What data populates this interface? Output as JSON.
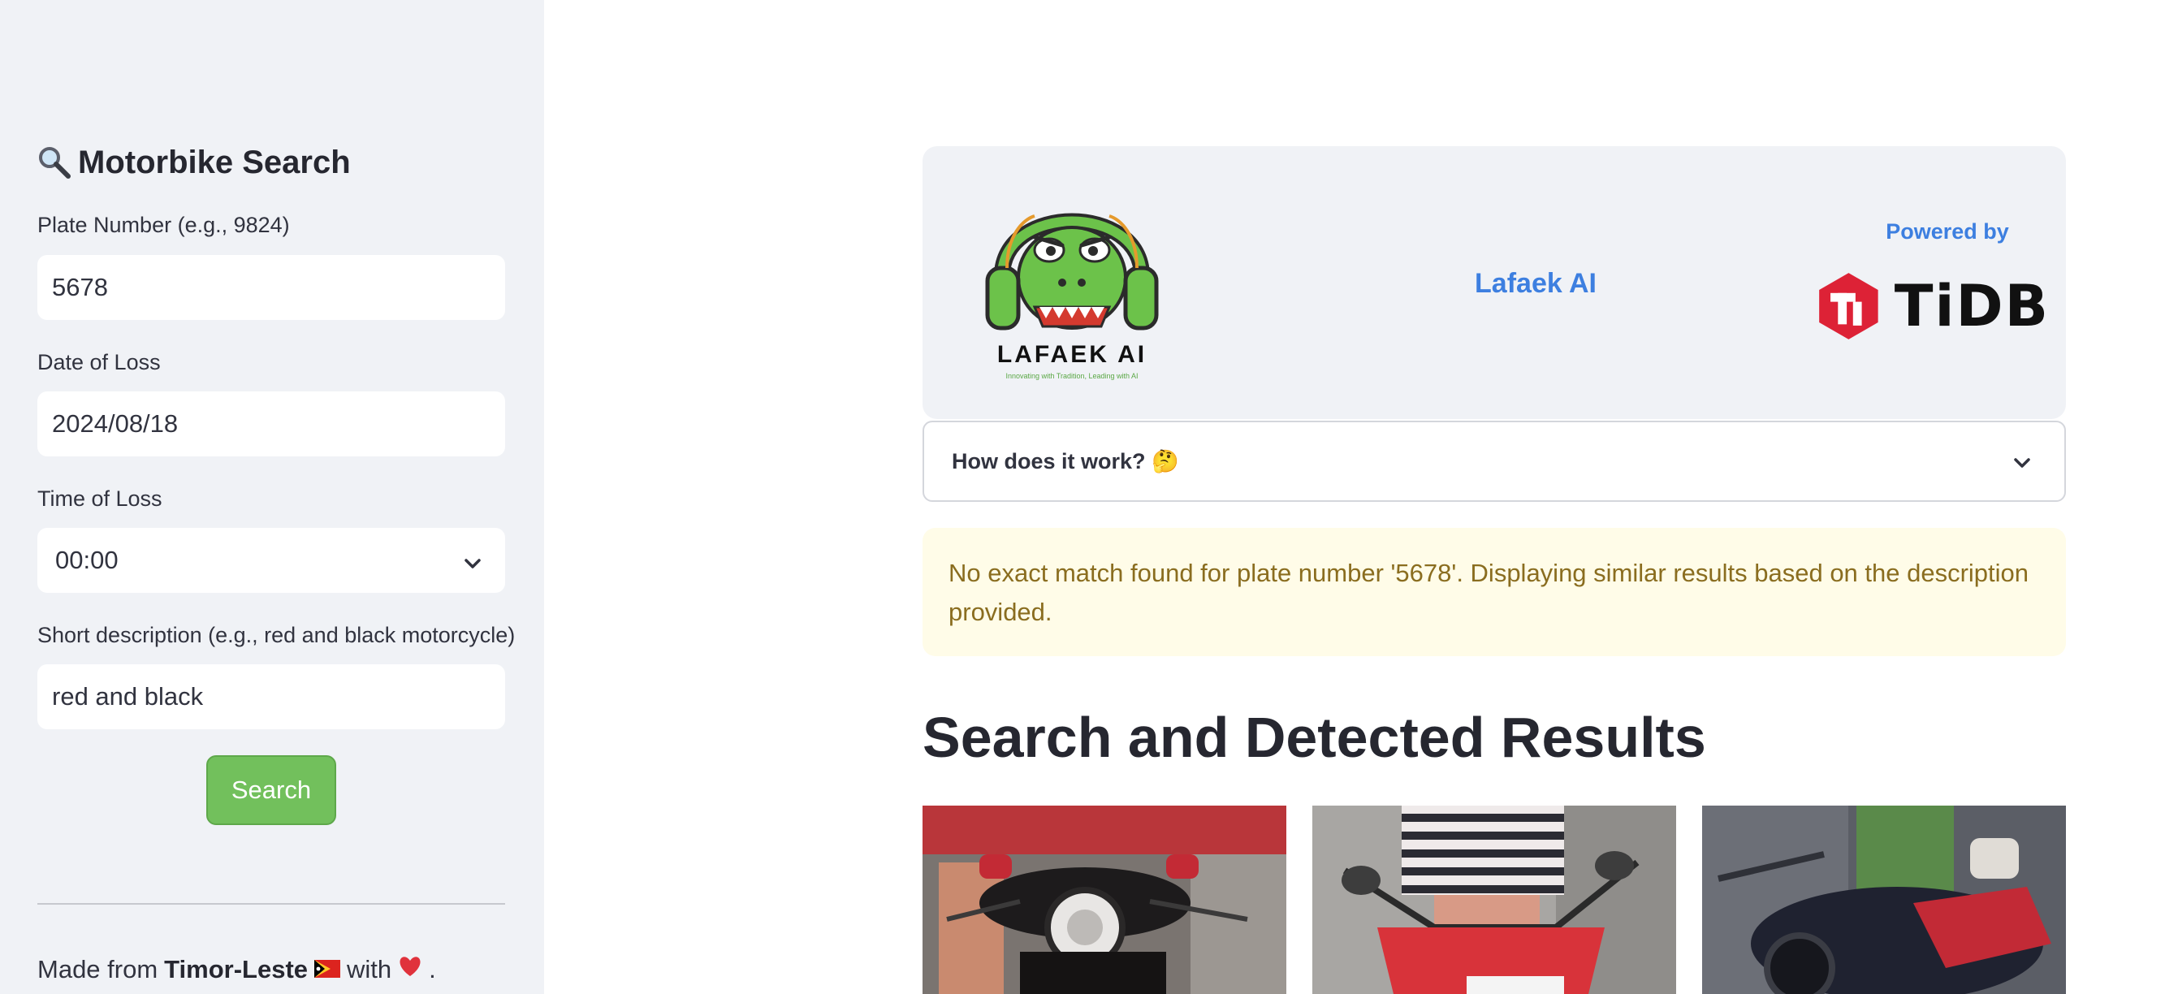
{
  "sidebar": {
    "title": "Motorbike Search",
    "title_icon": "magnifier-icon",
    "plate": {
      "label": "Plate Number (e.g., 9824)",
      "value": "5678"
    },
    "date": {
      "label": "Date of Loss",
      "value": "2024/08/18"
    },
    "time": {
      "label": "Time of Loss",
      "value": "00:00"
    },
    "description": {
      "label": "Short description (e.g., red and black motorcycle)",
      "value": "red and black"
    },
    "search_button": "Search",
    "footer": {
      "prefix": "Made from",
      "country": "Timor-Leste",
      "with": "with",
      "suffix": "."
    }
  },
  "header": {
    "logo_text": "LAFAEK AI",
    "logo_tagline": "Innovating with Tradition, Leading with AI",
    "brand_name": "Lafaek AI",
    "powered_by": "Powered by",
    "partner_logo_text": "TiDB"
  },
  "expander": {
    "label": "How does it work? 🤔"
  },
  "warning": {
    "text": "No exact match found for plate number '5678'. Displaying similar results based on the description provided."
  },
  "results": {
    "title": "Search and Detected Results",
    "thumbnails": [
      {
        "alt": "rider on red and black motorbike, front view"
      },
      {
        "alt": "rider in striped top on red scooter"
      },
      {
        "alt": "dark scooter with red accents"
      }
    ]
  },
  "colors": {
    "sidebar_bg": "#f0f2f6",
    "accent_blue": "#3d7fe0",
    "search_green": "#72c05c",
    "warning_bg": "#fffce8",
    "warning_text": "#8a6d1f",
    "tidb_red": "#dd2236"
  }
}
